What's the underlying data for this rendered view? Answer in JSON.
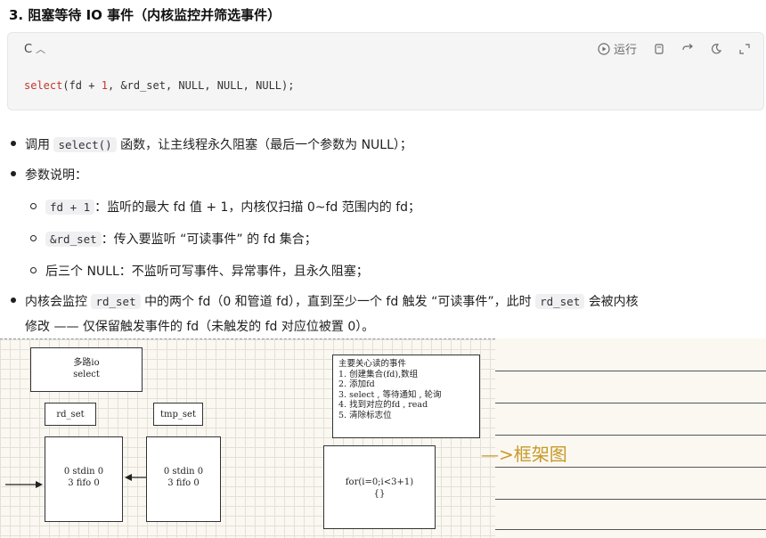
{
  "heading": "3. 阻塞等待 IO 事件（内核监控并筛选事件）",
  "code_block": {
    "language": "C",
    "chevron_icon": "chevron-up-icon",
    "run_label": "运行",
    "code": {
      "fn": "select",
      "pre": "(fd + ",
      "num": "1",
      "post": ", &rd_set, NULL, NULL, NULL);"
    }
  },
  "bullets": {
    "b1": {
      "prefix": "调用",
      "code": "select()",
      "suffix": "函数，让主线程永久阻塞（最后一个参数为 NULL）；"
    },
    "b2": {
      "text": "参数说明："
    },
    "s1": {
      "code": "fd + 1",
      "suffix": "：监听的最大 fd 值 + 1，内核仅扫描 0~fd 范围内的 fd；"
    },
    "s2": {
      "code": "&rd_set",
      "suffix": "：传入要监听 “可读事件” 的 fd 集合；"
    },
    "s3": {
      "text": "后三个 NULL：不监听可写事件、异常事件，且永久阻塞；"
    },
    "b3": {
      "prefix": "内核会监控",
      "code": "rd_set",
      "mid": "中的两个 fd（0 和管道 fd），直到至少一个 fd 触发 “可读事件”，此时",
      "code2": "rd_set",
      "suffix": "会被内核"
    },
    "b3_line2": "修改 —— 仅保留触发事件的 fd（未触发的 fd 对应位被置 0）。"
  },
  "sketch": {
    "box_title": [
      "多路io",
      "select"
    ],
    "rd_set": "rd_set",
    "tmp_set": "tmp_set",
    "left_box": [
      "0 stdin 0",
      "3 fifo 0"
    ],
    "right_box": [
      "0 stdin 0",
      "3 fifo 0"
    ],
    "note": [
      "主要关心读的事件",
      "1. 创建集合(fd),数组",
      "2. 添加fd",
      "3. select , 等待通知 , 轮询",
      "4. 找到对应的fd , read",
      "5. 清除标志位"
    ],
    "loop_box": [
      "for(i=0;i<3+1)",
      "{}"
    ],
    "handwriting": "—>框架图"
  }
}
